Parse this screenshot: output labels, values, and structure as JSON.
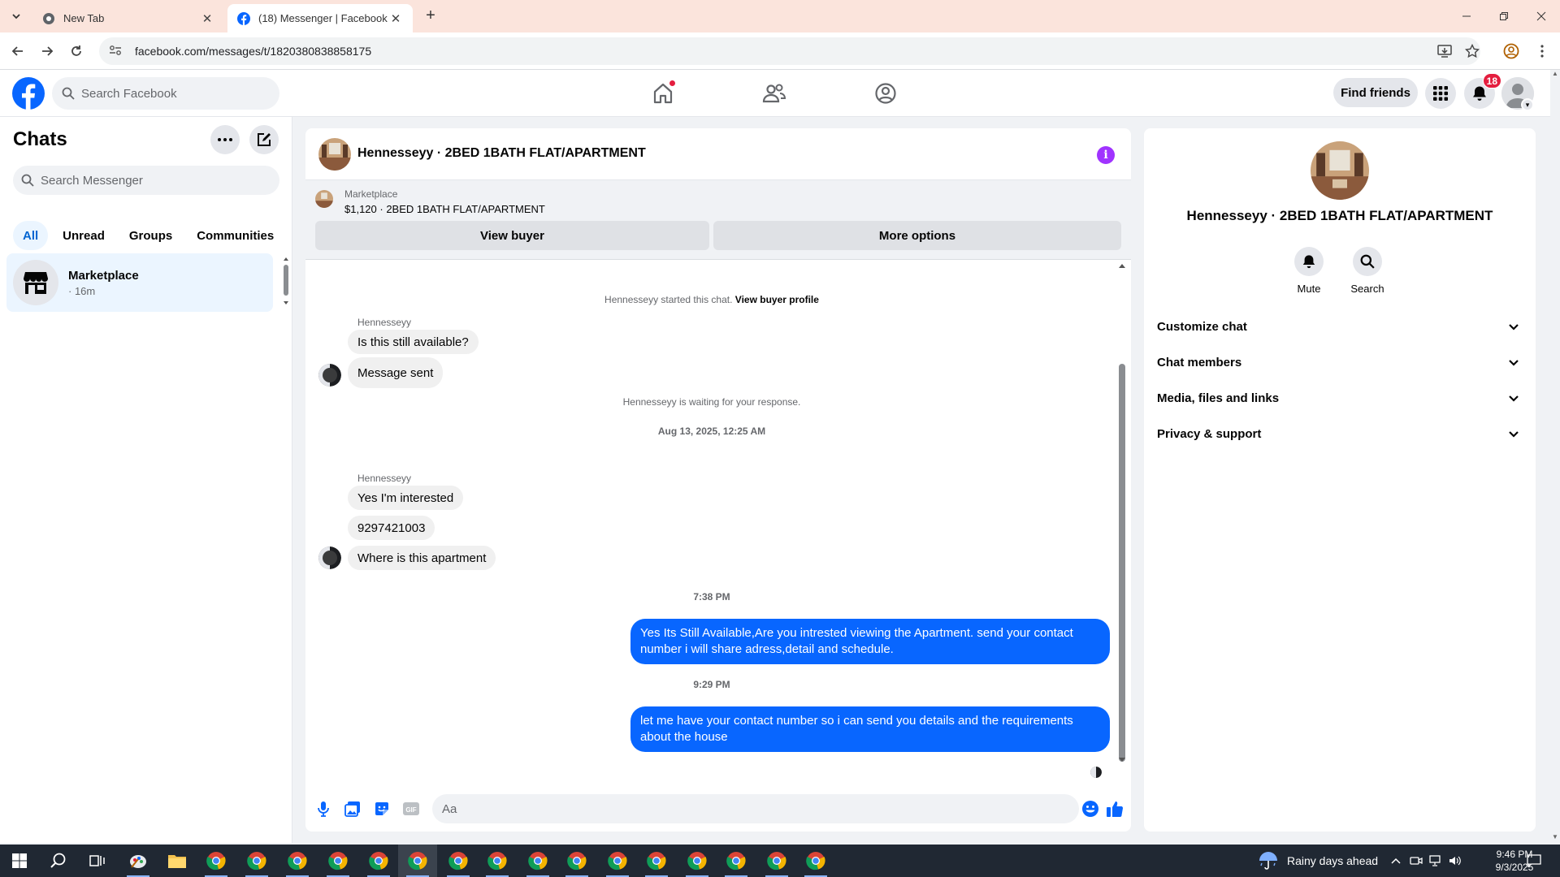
{
  "browser": {
    "tabs": [
      {
        "title": "New Tab",
        "active": false
      },
      {
        "title": "(18) Messenger | Facebook",
        "active": true
      }
    ],
    "url": "facebook.com/messages/t/1820380838858175"
  },
  "fb_header": {
    "search_placeholder": "Search Facebook",
    "find_friends": "Find friends",
    "notification_count": "18",
    "colors": {
      "brand": "#0866ff",
      "badge": "#e41e3f"
    }
  },
  "sidebar": {
    "title": "Chats",
    "search_placeholder": "Search Messenger",
    "filters": [
      {
        "label": "All",
        "active": true
      },
      {
        "label": "Unread",
        "active": false
      },
      {
        "label": "Groups",
        "active": false
      },
      {
        "label": "Communities",
        "active": false
      }
    ],
    "chats": [
      {
        "name": "Marketplace",
        "time": "· 16m",
        "icon": "storefront-icon"
      }
    ]
  },
  "conversation": {
    "title": "Hennesseyy · 2BED 1BATH FLAT/APARTMENT",
    "marketplace": {
      "label": "Marketplace",
      "item": "$1,120 · 2BED 1BATH FLAT/APARTMENT",
      "view_buyer": "View buyer",
      "more_options": "More options"
    },
    "started_text": "Hennesseyy started this chat.",
    "view_buyer_profile": "View buyer profile",
    "group1": {
      "sender": "Hennesseyy",
      "messages": [
        "Is this still available?",
        "Message sent"
      ]
    },
    "waiting_text": "Hennesseyy is waiting for your response.",
    "date_separator": "Aug 13, 2025, 12:25 AM",
    "group2": {
      "sender": "Hennesseyy",
      "messages": [
        "Yes I'm interested",
        "9297421003",
        "Where is this apartment"
      ]
    },
    "time1": "7:38 PM",
    "outgoing1": "Yes Its Still Available,Are you intrested viewing the Apartment. send your contact number i will share adress,detail and schedule.",
    "time2": "9:29 PM",
    "outgoing2": "let me have your contact number so i can send you details and the requirements about the house",
    "composer_placeholder": "Aa",
    "colors": {
      "outgoing_bubble": "#0866ff",
      "incoming_bubble": "#f0f0f0",
      "info_icon": "#a033ff"
    }
  },
  "info_panel": {
    "title": "Hennesseyy · 2BED 1BATH FLAT/APARTMENT",
    "actions": [
      {
        "label": "Mute",
        "icon": "bell-icon"
      },
      {
        "label": "Search",
        "icon": "search-icon"
      }
    ],
    "sections": [
      "Customize chat",
      "Chat members",
      "Media, files and links",
      "Privacy & support"
    ]
  },
  "taskbar": {
    "weather": "Rainy days ahead",
    "time": "9:46 PM",
    "date": "9/3/2025"
  }
}
